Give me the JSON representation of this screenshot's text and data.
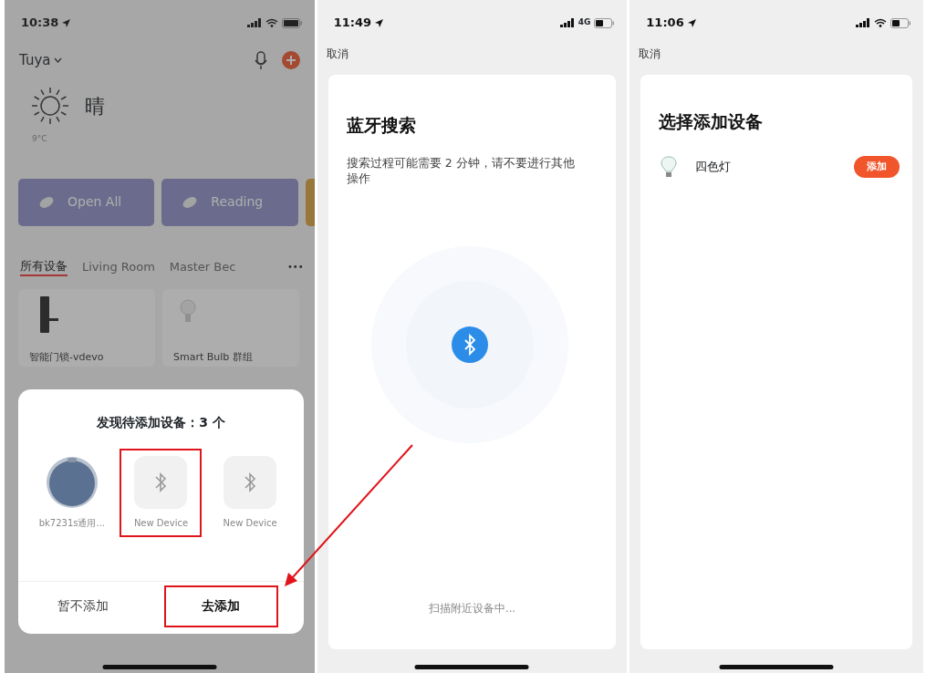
{
  "screens": [
    {
      "kind": "home",
      "status_bar": {
        "time": "10:38",
        "wifi": true
      },
      "home_name": "Tuya",
      "weather": {
        "condition": "晴",
        "temperature": "9°C"
      },
      "scenes": [
        {
          "label": "Open All"
        },
        {
          "label": "Reading"
        }
      ],
      "room_tabs": [
        {
          "label": "所有设备",
          "selected": true
        },
        {
          "label": "Living Room",
          "selected": false
        },
        {
          "label": "Master Bec",
          "selected": false
        }
      ],
      "more": "•••",
      "devices": [
        {
          "name": "智能门锁-vdevo",
          "kind": "lock"
        },
        {
          "name": "Smart Bulb 群组",
          "kind": "bulb"
        }
      ],
      "dialog": {
        "title": "发现待添加设备：3 个",
        "devices": [
          {
            "name": "bk7231s通用...",
            "kind": "robot",
            "highlighted": false
          },
          {
            "name": "New Device",
            "kind": "bluetooth",
            "highlighted": true
          },
          {
            "name": "New Device",
            "kind": "bluetooth",
            "highlighted": false
          }
        ],
        "buttons": [
          {
            "label": "暂不添加",
            "emphasis": false,
            "highlighted": false
          },
          {
            "label": "去添加",
            "emphasis": true,
            "highlighted": true
          }
        ]
      }
    },
    {
      "kind": "search",
      "status_bar": {
        "time": "11:49",
        "wifi": false,
        "network_label": "4G"
      },
      "cancel": "取消",
      "title": "蓝牙搜索",
      "description": "搜索过程可能需要 2 分钟，请不要进行其他操作",
      "status": "扫描附近设备中..."
    },
    {
      "kind": "select",
      "status_bar": {
        "time": "11:06",
        "wifi": true
      },
      "cancel": "取消",
      "title": "选择添加设备",
      "devices": [
        {
          "name": "四色灯",
          "action": "添加"
        }
      ]
    }
  ]
}
